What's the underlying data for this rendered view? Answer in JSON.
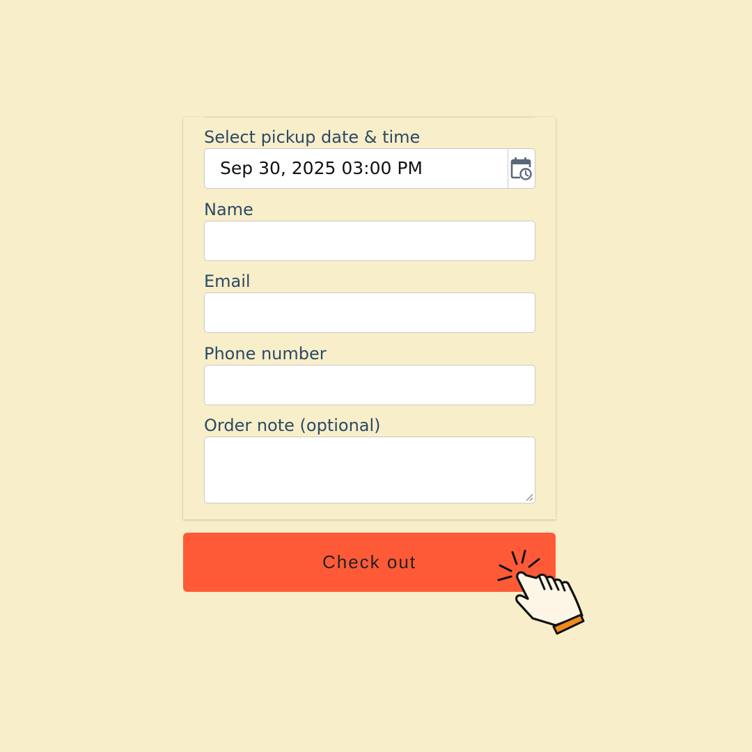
{
  "form": {
    "pickup_label": "Select pickup date & time",
    "pickup_value": "Sep 30, 2025 03:00 PM",
    "name_label": "Name",
    "name_value": "",
    "email_label": "Email",
    "email_value": "",
    "phone_label": "Phone number",
    "phone_value": "",
    "note_label": "Order note (optional)",
    "note_value": ""
  },
  "checkout": {
    "label": "Check out"
  },
  "icons": {
    "calendar": "calendar-clock-icon",
    "cursor": "hand-pointer-click-icon",
    "resize": "resize-grip-icon"
  },
  "colors": {
    "background": "#f8eec9",
    "label_text": "#2a4a65",
    "checkout_button": "#fe5a37",
    "calendar_icon": "#58677a",
    "cursor_cuff": "#f08a1c"
  }
}
